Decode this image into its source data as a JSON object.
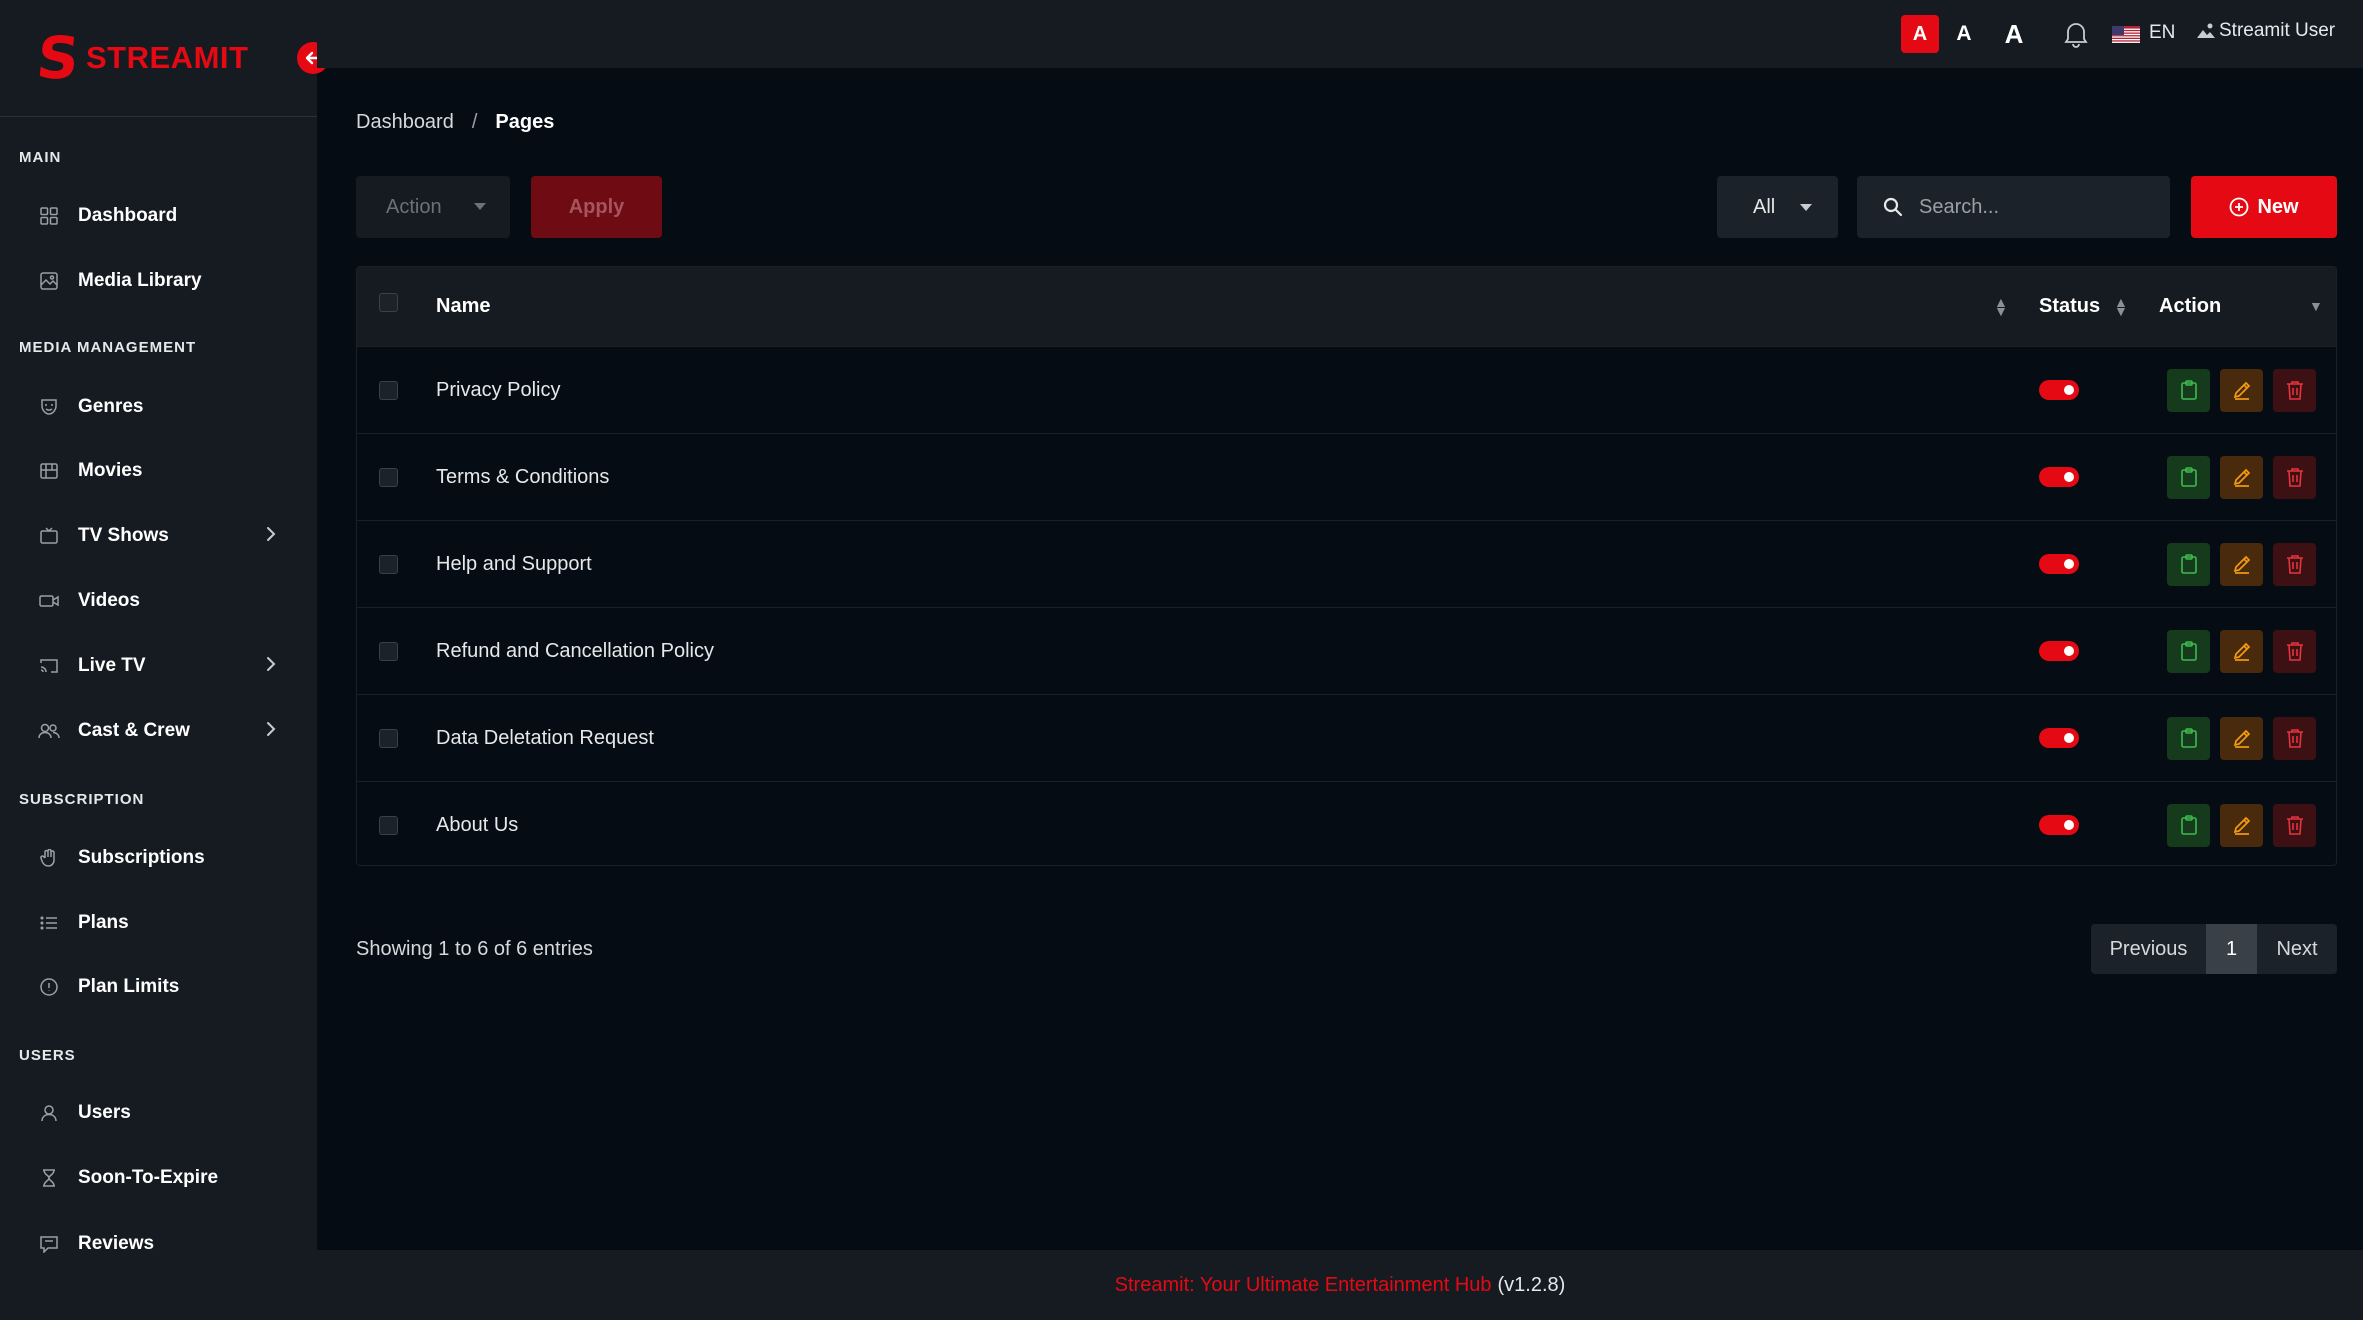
{
  "brand": {
    "name": "STREAMIT",
    "accent": "#e50914"
  },
  "sidebar": {
    "sections": [
      "MAIN",
      "MEDIA MANAGEMENT",
      "SUBSCRIPTION",
      "USERS"
    ],
    "items": [
      {
        "label": "Dashboard",
        "icon": "grid-icon"
      },
      {
        "label": "Media Library",
        "icon": "image-icon"
      },
      {
        "label": "Genres",
        "icon": "mask-icon"
      },
      {
        "label": "Movies",
        "icon": "film-icon"
      },
      {
        "label": "TV Shows",
        "icon": "tv-icon",
        "expandable": true
      },
      {
        "label": "Videos",
        "icon": "video-icon"
      },
      {
        "label": "Live TV",
        "icon": "cast-icon",
        "expandable": true
      },
      {
        "label": "Cast & Crew",
        "icon": "people-icon",
        "expandable": true
      },
      {
        "label": "Subscriptions",
        "icon": "hand-icon"
      },
      {
        "label": "Plans",
        "icon": "list-icon"
      },
      {
        "label": "Plan Limits",
        "icon": "info-icon"
      },
      {
        "label": "Users",
        "icon": "user-icon"
      },
      {
        "label": "Soon-To-Expire",
        "icon": "hourglass-icon"
      },
      {
        "label": "Reviews",
        "icon": "review-icon"
      }
    ]
  },
  "topbar": {
    "font_sizes": [
      "A",
      "A",
      "A"
    ],
    "language": "EN",
    "user_name": "Streamit User"
  },
  "breadcrumb": {
    "parent": "Dashboard",
    "separator": "/",
    "current": "Pages"
  },
  "toolbar": {
    "action_label": "Action",
    "apply_label": "Apply",
    "filter_value": "All",
    "search_placeholder": "Search...",
    "new_label": "New"
  },
  "table": {
    "columns": {
      "name": "Name",
      "status": "Status",
      "action": "Action"
    },
    "rows": [
      {
        "name": "Privacy Policy",
        "status": true
      },
      {
        "name": "Terms & Conditions",
        "status": true
      },
      {
        "name": "Help and Support",
        "status": true
      },
      {
        "name": "Refund and Cancellation Policy",
        "status": true
      },
      {
        "name": "Data Deletation Request",
        "status": true
      },
      {
        "name": "About Us",
        "status": true
      }
    ]
  },
  "summary": "Showing 1 to 6 of 6 entries",
  "pagination": {
    "previous": "Previous",
    "current": "1",
    "next": "Next"
  },
  "footer": {
    "link_text": "Streamit: Your Ultimate Entertainment Hub",
    "version": "(v1.2.8)"
  }
}
